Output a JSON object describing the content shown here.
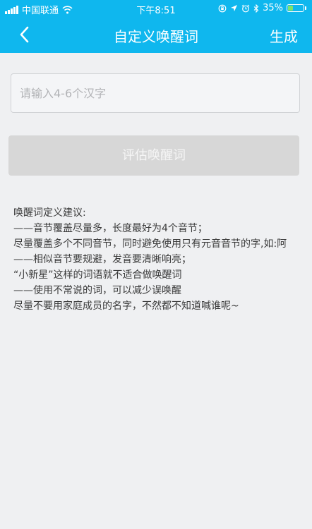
{
  "status_bar": {
    "carrier": "中国联通",
    "time": "下午8:51",
    "battery_percent": "35%",
    "battery_level": 0.35
  },
  "nav": {
    "title": "自定义唤醒词",
    "generate_label": "生成"
  },
  "input": {
    "placeholder": "请输入4-6个汉字",
    "value": ""
  },
  "evaluate_button": {
    "label": "评估唤醒词"
  },
  "tips": {
    "heading": "唤醒词定义建议:",
    "items": [
      "——音节覆盖尽量多，长度最好为4个音节；",
      "尽量覆盖多个不同音节，同时避免使用只有元音音节的字,如:阿",
      "——相似音节要规避，发音要清晰响亮；",
      "“小新星”这样的词语就不适合做唤醒词",
      "——使用不常说的词，可以减少误唤醒",
      "尽量不要用家庭成员的名字，不然都不知道喊谁呢~"
    ]
  },
  "colors": {
    "header": "#0fb7ee",
    "background": "#eff0f2",
    "button_disabled": "#d7d7d7"
  },
  "icons": [
    "signal-bars-icon",
    "wifi-icon",
    "back-arrow-icon",
    "orientation-lock-icon",
    "location-icon",
    "alarm-icon",
    "bluetooth-icon",
    "battery-icon"
  ]
}
